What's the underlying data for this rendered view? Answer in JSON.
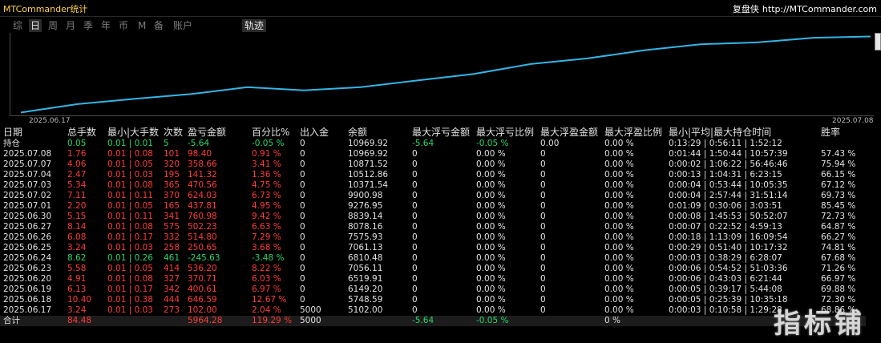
{
  "header": {
    "app_title": "MTCommander统计",
    "brand": "复盘侠",
    "url": "http://MTCommander.com"
  },
  "tabs": [
    {
      "label": "综"
    },
    {
      "label": "日"
    },
    {
      "label": "周"
    },
    {
      "label": "月"
    },
    {
      "label": "季"
    },
    {
      "label": "年"
    },
    {
      "label": "币"
    },
    {
      "label": "M"
    },
    {
      "label": "备"
    },
    {
      "label": "账户"
    }
  ],
  "active_tab_index": 1,
  "track_tab": {
    "label": "轨迹"
  },
  "colors": {
    "line": "#33b5e5",
    "red": "#ff3b3b",
    "green": "#2ad56b",
    "text": "#d8d8d8"
  },
  "chart_data": {
    "type": "line",
    "x_labels": [
      "2025.06.17",
      "2025.07.08"
    ],
    "series": [
      {
        "values": [
          5102.0,
          5748.59,
          6149.2,
          6519.91,
          7056.11,
          6810.48,
          7061.13,
          7575.93,
          8078.16,
          8839.14,
          9276.95,
          9900.98,
          10371.54,
          10512.86,
          10871.52,
          10969.92
        ]
      }
    ],
    "ylim": [
      5000,
      11000
    ]
  },
  "table": {
    "columns": [
      "日期",
      "总手数",
      "最小|大手数",
      "次数",
      "盈亏金额",
      "百分比%",
      "出入金",
      "余额",
      "最大浮亏金额",
      "最大浮亏比例",
      "最大浮盈金额",
      "最大浮盈比例",
      "最小|平均|最大持仓时间",
      "胜率"
    ],
    "hold": [
      "持仓",
      "0.05",
      "0.01 | 0.01",
      "5",
      "-5.64",
      "-0.05 %",
      "0",
      "10969.92",
      "-5.64",
      "-0.05 %",
      "0.00",
      "0.00 %",
      "0:13:29 | 0:56:11 | 1:52:12",
      ""
    ],
    "rows": [
      {
        "tone": "red",
        "cells": [
          "2025.07.08",
          "1.76",
          "0.01 | 0.08",
          "101",
          "98.40",
          "0.91 %",
          "0",
          "10969.92",
          "0",
          "0.00 %",
          "0",
          "0.00 %",
          "0:01:44 | 1:50:44 | 10:57:39",
          "57.43 %"
        ]
      },
      {
        "tone": "red",
        "cells": [
          "2025.07.07",
          "4.06",
          "0.01 | 0.05",
          "320",
          "358.66",
          "3.41 %",
          "0",
          "10871.52",
          "0",
          "0.00 %",
          "0",
          "0.00 %",
          "0:00:02 | 1:06:22 | 56:46:46",
          "75.94 %"
        ]
      },
      {
        "tone": "red",
        "cells": [
          "2025.07.04",
          "2.47",
          "0.01 | 0.03",
          "195",
          "141.32",
          "1.36 %",
          "0",
          "10512.86",
          "0",
          "0.00 %",
          "0",
          "0.00 %",
          "0:00:13 | 1:04:31 | 6:23:15",
          "66.15 %"
        ]
      },
      {
        "tone": "red",
        "cells": [
          "2025.07.03",
          "5.34",
          "0.01 | 0.08",
          "365",
          "470.56",
          "4.75 %",
          "0",
          "10371.54",
          "0",
          "0.00 %",
          "0",
          "0.00 %",
          "0:00:04 | 0:53:44 | 10:05:35",
          "67.12 %"
        ]
      },
      {
        "tone": "red",
        "cells": [
          "2025.07.02",
          "7.11",
          "0.01 | 0.11",
          "370",
          "624.03",
          "6.73 %",
          "0",
          "9900.98",
          "0",
          "0.00 %",
          "0",
          "0.00 %",
          "0:00:04 | 2:57:44 | 31:51:14",
          "69.73 %"
        ]
      },
      {
        "tone": "red",
        "cells": [
          "2025.07.01",
          "2.20",
          "0.01 | 0.05",
          "165",
          "437.81",
          "4.95 %",
          "0",
          "9276.95",
          "0",
          "0.00 %",
          "0",
          "0.00 %",
          "0:01:09 | 0:30:06 | 3:03:51",
          "85.45 %"
        ]
      },
      {
        "tone": "red",
        "cells": [
          "2025.06.30",
          "5.15",
          "0.01 | 0.11",
          "341",
          "760.98",
          "9.42 %",
          "0",
          "8839.14",
          "0",
          "0.00 %",
          "0",
          "0.00 %",
          "0:00:08 | 1:45:53 | 50:52:07",
          "72.73 %"
        ]
      },
      {
        "tone": "red",
        "cells": [
          "2025.06.27",
          "8.14",
          "0.01 | 0.08",
          "575",
          "502.23",
          "6.63 %",
          "0",
          "8078.16",
          "0",
          "0.00 %",
          "0",
          "0.00 %",
          "0:00:07 | 0:22:52 | 4:59:13",
          "64.87 %"
        ]
      },
      {
        "tone": "red",
        "cells": [
          "2025.06.26",
          "6.08",
          "0.01 | 0.17",
          "332",
          "514.80",
          "7.29 %",
          "0",
          "7575.93",
          "0",
          "0.00 %",
          "0",
          "0.00 %",
          "0:00:18 | 1:13:09 | 16:09:54",
          "66.27 %"
        ]
      },
      {
        "tone": "red",
        "cells": [
          "2025.06.25",
          "3.24",
          "0.01 | 0.03",
          "258",
          "250.65",
          "3.68 %",
          "0",
          "7061.13",
          "0",
          "0.00 %",
          "0",
          "0.00 %",
          "0:00:29 | 0:51:40 | 10:17:32",
          "74.81 %"
        ]
      },
      {
        "tone": "green",
        "cells": [
          "2025.06.24",
          "8.62",
          "0.01 | 0.26",
          "461",
          "-245.63",
          "-3.48 %",
          "0",
          "6810.48",
          "0",
          "0.00 %",
          "0",
          "0.00 %",
          "0:00:03 | 0:38:29 | 6:28:07",
          "67.68 %"
        ]
      },
      {
        "tone": "red",
        "cells": [
          "2025.06.23",
          "5.58",
          "0.01 | 0.05",
          "414",
          "536.20",
          "8.22 %",
          "0",
          "7056.11",
          "0",
          "0.00 %",
          "0",
          "0.00 %",
          "0:00:06 | 0:54:52 | 51:03:36",
          "71.26 %"
        ]
      },
      {
        "tone": "red",
        "cells": [
          "2025.06.20",
          "4.91",
          "0.01 | 0.08",
          "327",
          "370.71",
          "6.03 %",
          "0",
          "6519.91",
          "0",
          "0.00 %",
          "0",
          "0.00 %",
          "0:00:06 | 0:43:03 | 6:21:44",
          "66.97 %"
        ]
      },
      {
        "tone": "red",
        "cells": [
          "2025.06.19",
          "6.13",
          "0.01 | 0.17",
          "342",
          "400.61",
          "6.97 %",
          "0",
          "6149.20",
          "0",
          "0.00 %",
          "0",
          "0.00 %",
          "0:00:05 | 0:39:17 | 5:44:08",
          "69.88 %"
        ]
      },
      {
        "tone": "red",
        "cells": [
          "2025.06.18",
          "10.40",
          "0.01 | 0.38",
          "444",
          "646.59",
          "12.67 %",
          "0",
          "5748.59",
          "0",
          "0.00 %",
          "0",
          "0.00 %",
          "0:00:05 | 0:25:39 | 10:35:18",
          "72.30 %"
        ]
      },
      {
        "tone": "red",
        "cells": [
          "2025.06.17",
          "3.24",
          "0.01 | 0.03",
          "273",
          "102.00",
          "2.04 %",
          "5000",
          "5102.00",
          "0",
          "0.00 %",
          "0",
          "0.00 %",
          "0:00:03 | 0:10:58 | 1:29:28",
          "68.86 %"
        ]
      }
    ],
    "total": [
      "合计",
      "84.48",
      "",
      "",
      "5964.28",
      "119.29 %",
      "5000",
      "",
      "-5.64",
      "-0.05 %",
      "",
      "0 %",
      "",
      ""
    ]
  },
  "watermark": "指标铺"
}
